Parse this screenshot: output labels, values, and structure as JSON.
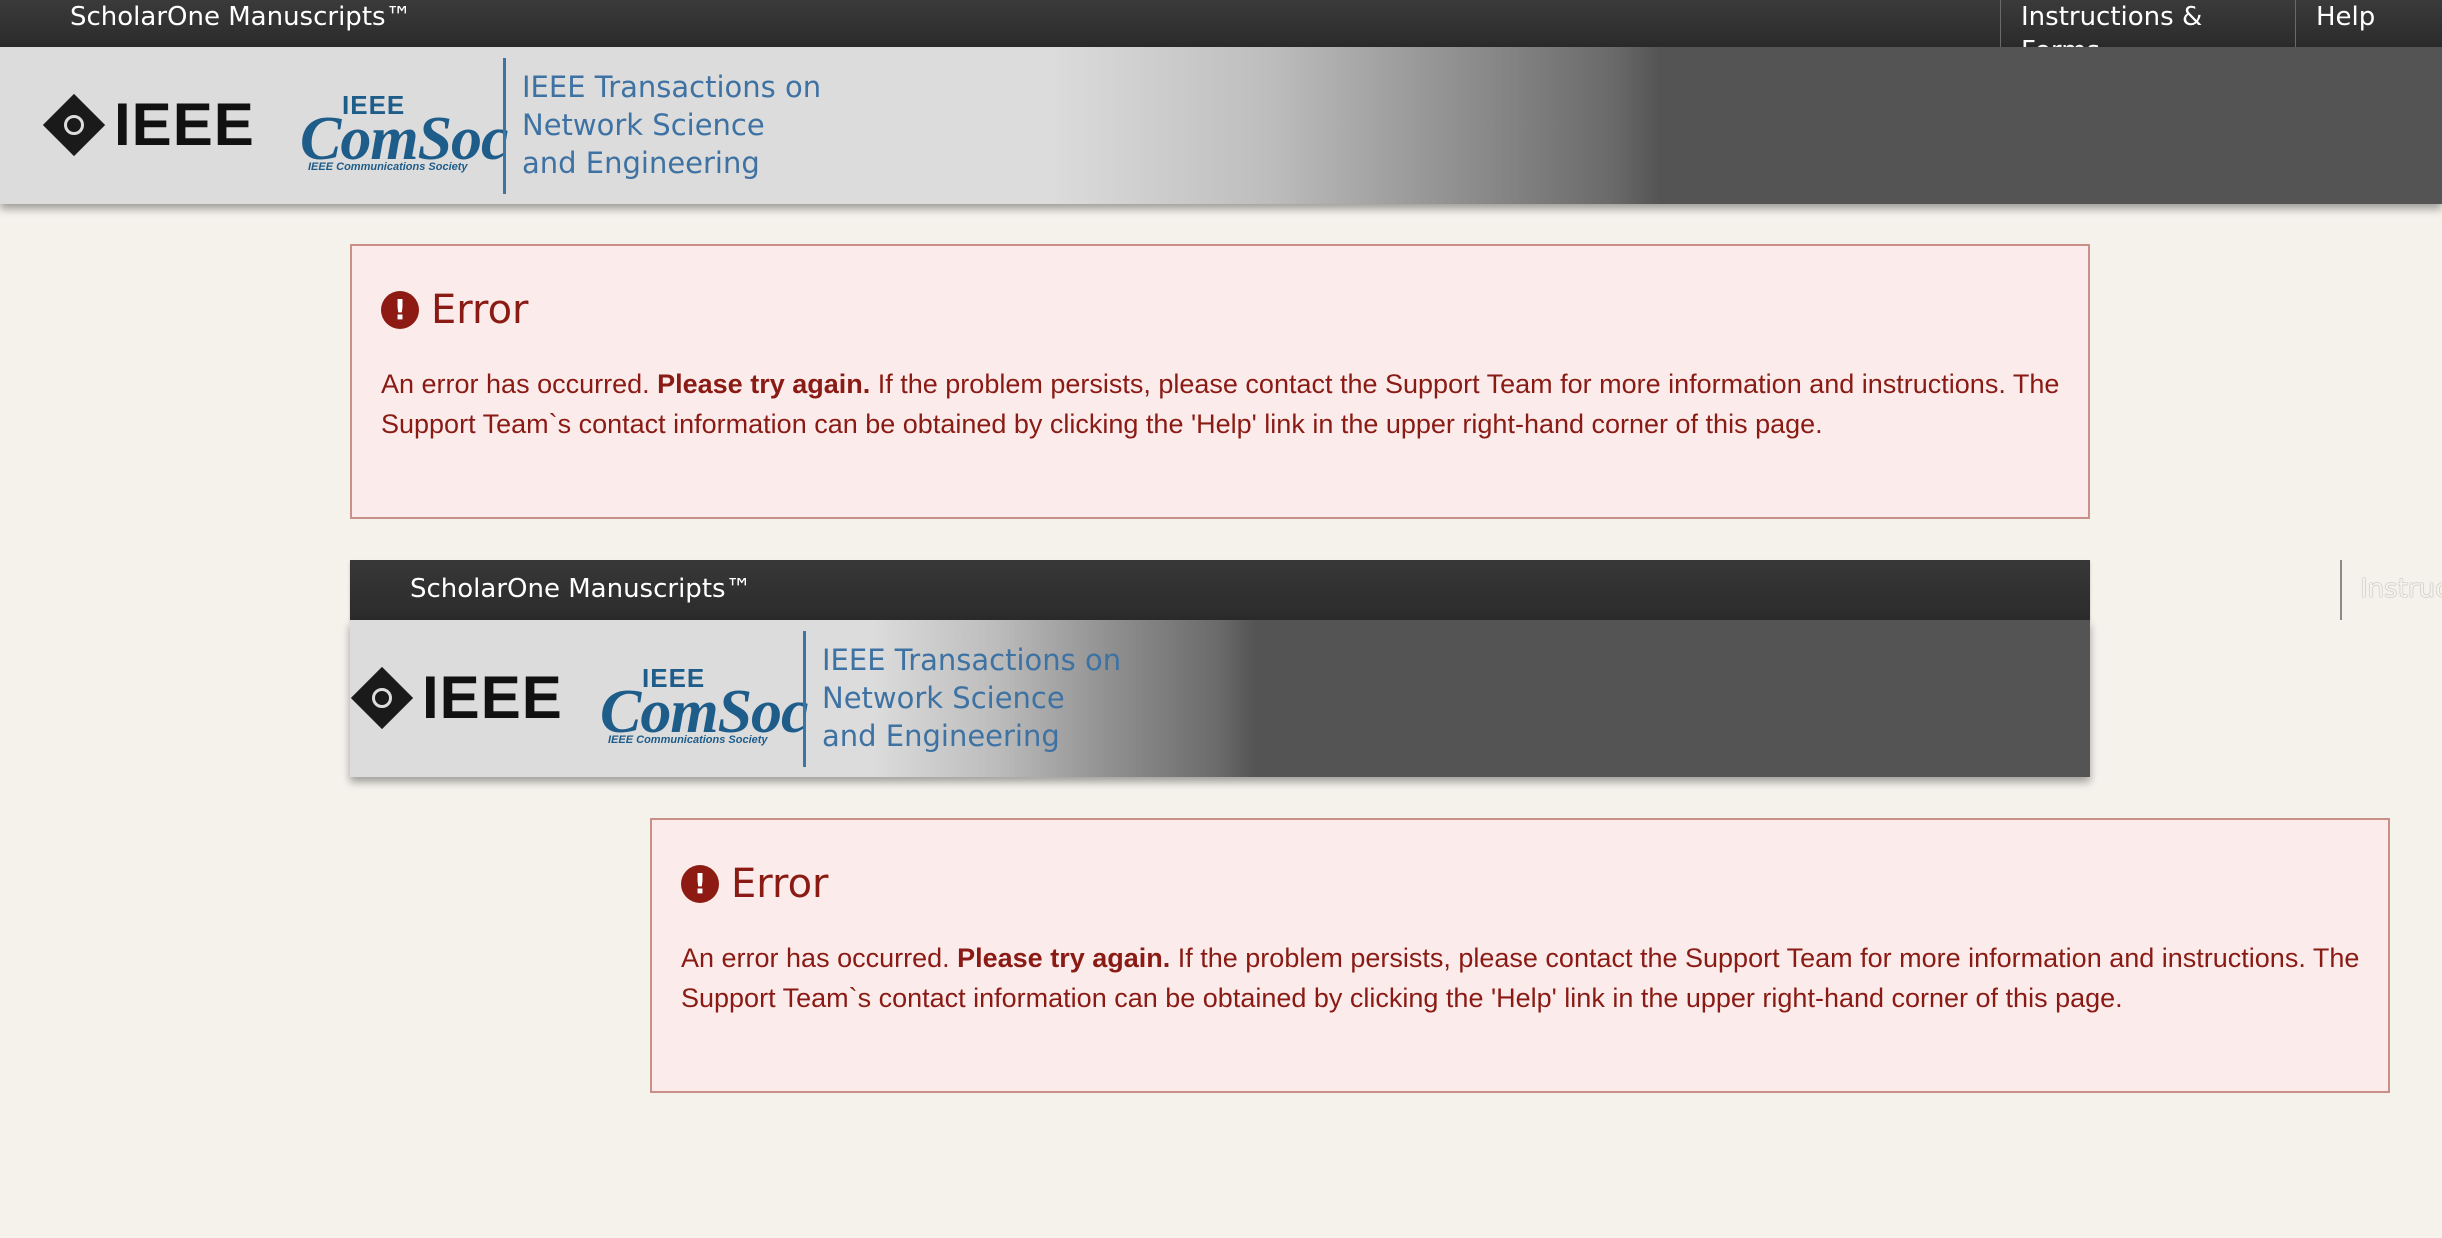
{
  "topbar": {
    "brand": "ScholarOne Manuscripts™",
    "nav": {
      "instructions": "Instructions & Forms",
      "help": "Help"
    }
  },
  "header": {
    "ieee_logo_text": "IEEE",
    "comsoc_logo": {
      "ieee": "IEEE",
      "name": "ComSoc",
      "society": "IEEE Communications Society"
    },
    "journal_title": {
      "line1": "IEEE Transactions on",
      "line2": "Network Science",
      "line3": "and Engineering"
    }
  },
  "error": {
    "icon": "!",
    "title": "Error",
    "message_start": "An error has occurred. ",
    "message_bold": "Please try again.",
    "message_end": " If the problem persists, please contact the Support Team for more information and instructions. The Support Team`s contact information can be obtained by clicking the 'Help' link in the upper right-hand corner of this page."
  },
  "embedded": {
    "brand": "ScholarOne Manuscripts™",
    "instructions_partial": "Instructions & Forms"
  },
  "colors": {
    "navbar": "#2f2f2f",
    "page_background": "#f5f2ec",
    "error_background": "#fbeceb",
    "error_border": "#c9908a",
    "error_text": "#8a1a14",
    "journal_title": "#3e72a3"
  }
}
